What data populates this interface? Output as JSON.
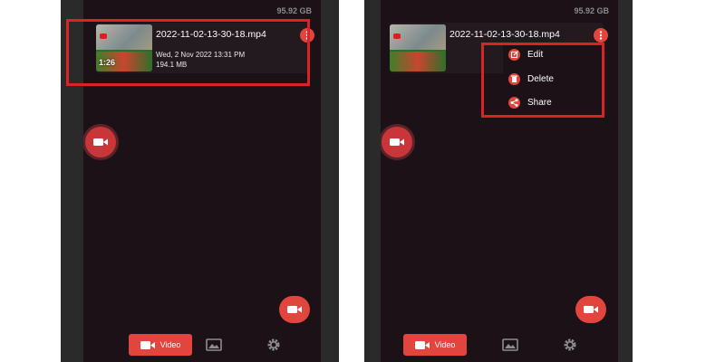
{
  "storage": "95.92 GB",
  "video": {
    "filename": "2022-11-02-13-30-18.mp4",
    "date": "Wed, 2 Nov 2022 13:31 PM",
    "size": "194.1 MB",
    "duration": "1:26"
  },
  "menu": {
    "edit": "Edit",
    "delete": "Delete",
    "share": "Share"
  },
  "nav": {
    "video_label": "Video"
  },
  "colors": {
    "accent": "#e1453d",
    "highlight": "#d92327",
    "background": "#1b1117"
  },
  "icons": [
    "more-vert-icon",
    "video-camera-icon",
    "image-icon",
    "gear-icon",
    "edit-icon",
    "delete-icon",
    "share-icon"
  ]
}
